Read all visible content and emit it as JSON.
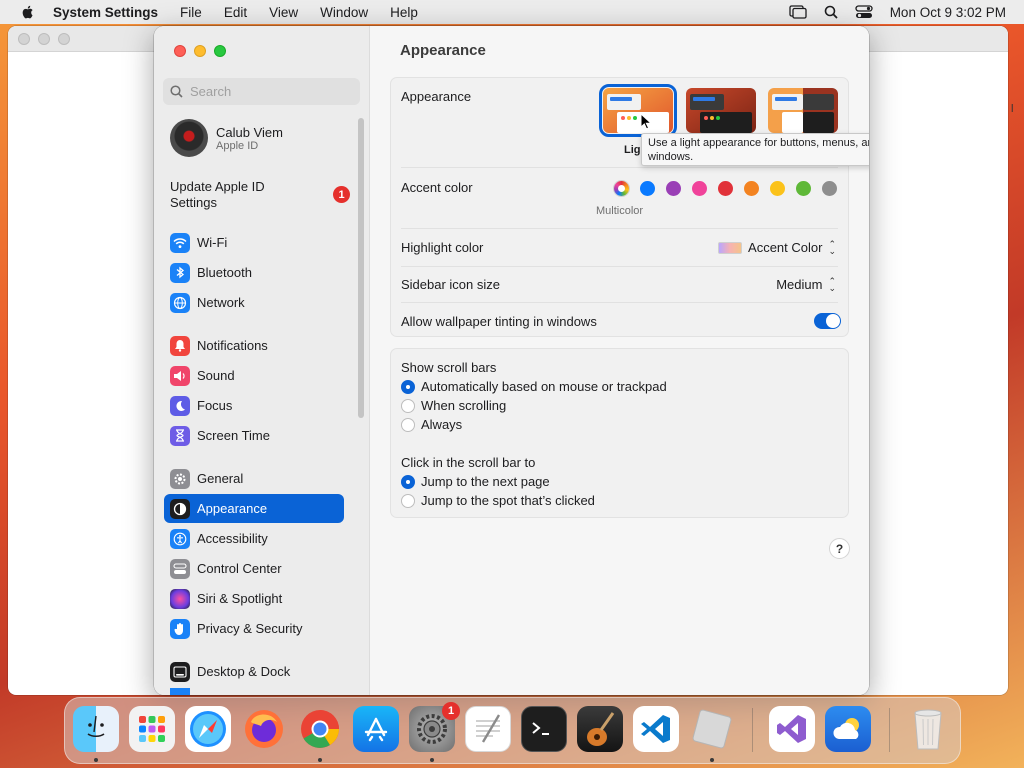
{
  "menubar": {
    "app_name": "System Settings",
    "menus": [
      "File",
      "Edit",
      "View",
      "Window",
      "Help"
    ],
    "clock": "Mon Oct 9  3:02 PM"
  },
  "sidebar": {
    "search_placeholder": "Search",
    "account": {
      "name": "Calub Viem",
      "subtitle": "Apple ID"
    },
    "update": {
      "label": "Update Apple ID Settings",
      "badge": "1"
    },
    "items": [
      {
        "label": "Wi-Fi",
        "icon": "wifi-icon",
        "color": "#1a82f7"
      },
      {
        "label": "Bluetooth",
        "icon": "bluetooth-icon",
        "color": "#1a82f7"
      },
      {
        "label": "Network",
        "icon": "globe-icon",
        "color": "#1a82f7"
      },
      {
        "label": "Notifications",
        "icon": "bell-icon",
        "color": "#f1453d"
      },
      {
        "label": "Sound",
        "icon": "speaker-icon",
        "color": "#f0456a"
      },
      {
        "label": "Focus",
        "icon": "moon-icon",
        "color": "#5e5ce6"
      },
      {
        "label": "Screen Time",
        "icon": "hourglass-icon",
        "color": "#6e5ce6"
      },
      {
        "label": "General",
        "icon": "gear-icon",
        "color": "#8e8e93"
      },
      {
        "label": "Appearance",
        "icon": "appearance-icon",
        "color": "#1d1d1f"
      },
      {
        "label": "Accessibility",
        "icon": "accessibility-icon",
        "color": "#1a82f7"
      },
      {
        "label": "Control Center",
        "icon": "control-center-icon",
        "color": "#8e8e93"
      },
      {
        "label": "Siri & Spotlight",
        "icon": "siri-icon",
        "color": "#b34fd6"
      },
      {
        "label": "Privacy & Security",
        "icon": "hand-icon",
        "color": "#1a82f7"
      },
      {
        "label": "Desktop & Dock",
        "icon": "dock-icon",
        "color": "#1d1d1f"
      }
    ]
  },
  "main": {
    "title": "Appearance",
    "appearance": {
      "label": "Appearance",
      "selected_partial_label": "Ligl",
      "tooltip": "Use a light appearance for buttons, menus, and windows."
    },
    "accent": {
      "label": "Accent color",
      "caption": "Multicolor",
      "colors": [
        "#0a7aff",
        "#9a3fb6",
        "#f0439a",
        "#e1323a",
        "#f38321",
        "#fbc21a",
        "#5fb838",
        "#8e8e8e"
      ]
    },
    "highlight": {
      "label": "Highlight color",
      "value": "Accent Color"
    },
    "icon_size": {
      "label": "Sidebar icon size",
      "value": "Medium"
    },
    "tinting": {
      "label": "Allow wallpaper tinting in windows",
      "on": true
    },
    "scroll_bars": {
      "label": "Show scroll bars",
      "options": [
        "Automatically based on mouse or trackpad",
        "When scrolling",
        "Always"
      ],
      "selected": 0
    },
    "click_scroll": {
      "label": "Click in the scroll bar to",
      "options": [
        "Jump to the next page",
        "Jump to the spot that’s clicked"
      ],
      "selected": 0
    },
    "help": "?"
  },
  "dock": {
    "items": [
      "Finder",
      "Launchpad",
      "Safari",
      "Firefox",
      "Chrome",
      "App Store",
      "System Settings",
      "TextEdit",
      "Terminal",
      "GarageBand",
      "Visual Studio Code",
      "Roblox",
      "Visual Studio",
      "Weather",
      "Trash"
    ],
    "settings_badge": "1"
  }
}
